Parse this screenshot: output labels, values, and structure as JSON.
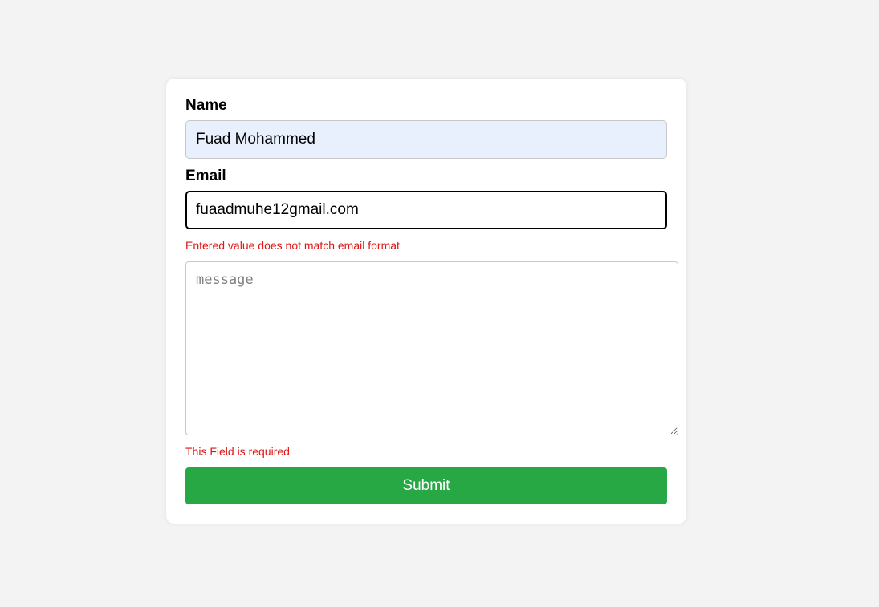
{
  "form": {
    "name": {
      "label": "Name",
      "value": "Fuad Mohammed"
    },
    "email": {
      "label": "Email",
      "value": "fuaadmuhe12gmail.com",
      "error": "Entered value does not match email format"
    },
    "message": {
      "placeholder": "message",
      "value": "",
      "error": "This Field is required"
    },
    "submit_label": "Submit"
  },
  "colors": {
    "page_background": "#f3f3f3",
    "card_background": "#ffffff",
    "autofill_background": "#e8f0fe",
    "error_text": "#e01515",
    "submit_background": "#28a745",
    "submit_text": "#ffffff"
  }
}
